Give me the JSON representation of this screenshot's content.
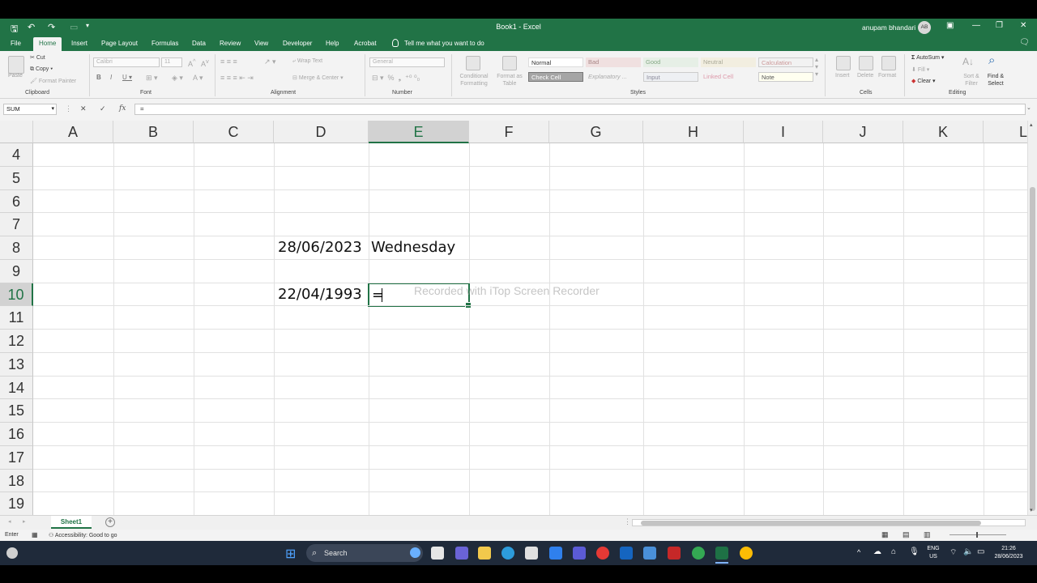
{
  "window": {
    "title": "Book1 - Excel",
    "user_name": "anupam bhandari",
    "user_initials": "AB"
  },
  "tabs": [
    "File",
    "Home",
    "Insert",
    "Page Layout",
    "Formulas",
    "Data",
    "Review",
    "View",
    "Developer",
    "Help",
    "Acrobat"
  ],
  "tell_me": "Tell me what you want to do",
  "ribbon": {
    "clipboard": {
      "paste": "Paste",
      "cut": "Cut",
      "copy": "Copy",
      "format_painter": "Format Painter",
      "label": "Clipboard"
    },
    "font": {
      "name": "Calibri",
      "size": "11",
      "label": "Font"
    },
    "alignment": {
      "wrap": "Wrap Text",
      "merge": "Merge & Center",
      "label": "Alignment"
    },
    "number": {
      "format": "General",
      "label": "Number"
    },
    "styles": {
      "conditional": "Conditional Formatting",
      "format_table": "Format as Table",
      "cells": [
        "Normal",
        "Bad",
        "Good",
        "Neutral",
        "Calculation",
        "Check Cell",
        "Explanatory ...",
        "Input",
        "Linked Cell",
        "Note"
      ],
      "label": "Styles"
    },
    "cells": {
      "insert": "Insert",
      "delete": "Delete",
      "format": "Format",
      "label": "Cells"
    },
    "editing": {
      "autosum": "AutoSum",
      "fill": "Fill",
      "clear": "Clear",
      "sort": "Sort & Filter",
      "find": "Find & Select",
      "label": "Editing"
    }
  },
  "formula_bar": {
    "name_box": "SUM",
    "formula": "="
  },
  "grid": {
    "columns": [
      "A",
      "B",
      "C",
      "D",
      "E",
      "F",
      "G",
      "H",
      "I",
      "J",
      "K",
      "L"
    ],
    "selected_column": "E",
    "rows": [
      "4",
      "5",
      "6",
      "7",
      "8",
      "9",
      "10",
      "11",
      "12",
      "13",
      "14",
      "15",
      "16",
      "17",
      "18",
      "19"
    ],
    "selected_row": "10",
    "cells": {
      "D8": "28/06/2023",
      "E8": "Wednesday",
      "D10": "22/04/1993",
      "E10": "="
    }
  },
  "watermark": "Recorded with iTop Screen Recorder",
  "sheet_tab": "Sheet1",
  "status": {
    "mode": "Enter",
    "accessibility": "Accessibility: Good to go"
  },
  "taskbar": {
    "search": "Search",
    "lang": "ENG",
    "region": "US",
    "time": "21:26",
    "date": "28/06/2023"
  }
}
